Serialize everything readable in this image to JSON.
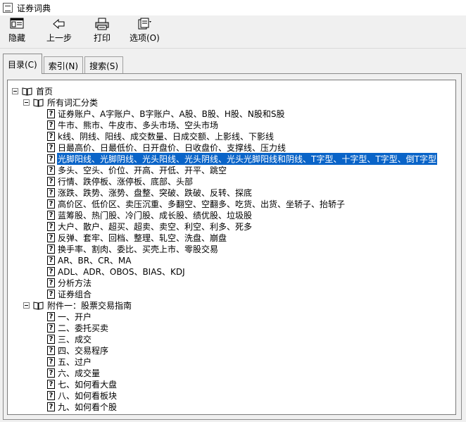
{
  "window": {
    "title": "证券词典"
  },
  "toolbar": {
    "hide_label": "隐藏",
    "back_label": "上一步",
    "print_label": "打印",
    "options_label": "选项(O)"
  },
  "tabs": [
    {
      "label": "目录(C)"
    },
    {
      "label": "索引(N)"
    },
    {
      "label": "搜索(S)"
    }
  ],
  "tree": {
    "root": "首页",
    "group1": {
      "label": "所有词汇分类",
      "items": [
        "证券账户、A字账户、B字账户、A股、B股、H股、N股和S股",
        "牛市、熊市、牛皮市、多头市场、空头市场",
        "k线、阴线、阳线、成交数量、日成交额、上影线、下影线",
        "日最高价、日最低价、日开盘价、日收盘价、支撑线、压力线",
        "光脚阳线、光脚阴线、光头阳线、光头阴线、光头光脚阳线和阴线、T字型、十字型、T字型、倒T字型",
        "多头、空头、价位、开高、开低、开平、跳空",
        "行情、跌停板、涨停板、底部、头部",
        "涨跌、跌势、涨势、盘整、突破、跌破、反转、探底",
        "高价区、低价区、卖压沉重、多翻空、空翻多、吃货、出货、坐轿子、抬轿子",
        "蓝筹股、热门股、冷门股、成长股、绩优股、垃圾股",
        "大户、散户、超买、超卖、卖空、利空、利多、死多",
        "反弹、套牢、回档、整理、轧空、洗盘、崩盘",
        "换手率、割肉、委比、买壳上市、零股交易",
        "AR、BR、CR、MA",
        "ADL、ADR、OBOS、BIAS、KDJ",
        "分析方法",
        "证券组合"
      ]
    },
    "group2": {
      "label": "附件一：股票交易指南",
      "items": [
        "一、开户",
        "二、委托买卖",
        "三、成交",
        "四、交易程序",
        "五、过户",
        "六、成交量",
        "七、如何看大盘",
        "八、如何看板块",
        "九、如何看个股"
      ]
    }
  }
}
